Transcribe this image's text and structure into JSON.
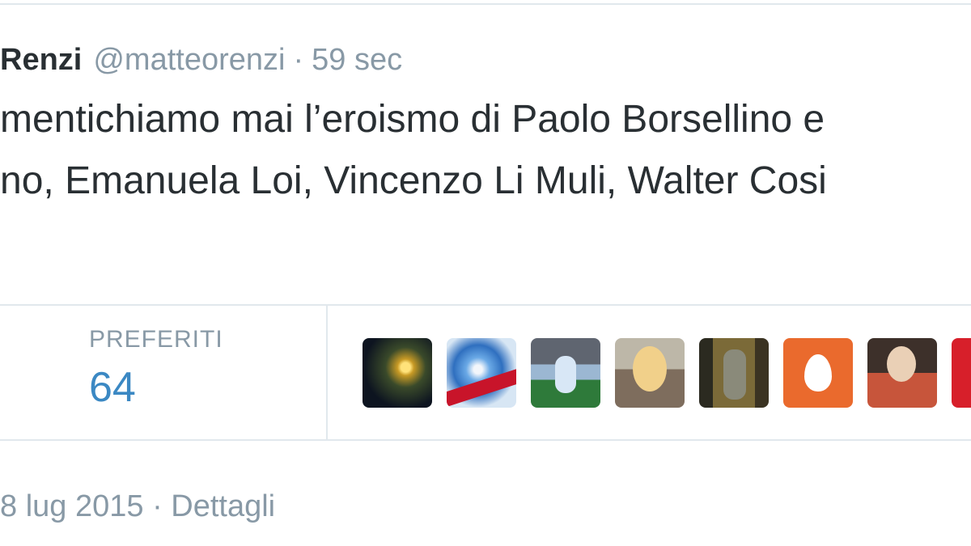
{
  "tweet": {
    "author_name": "Renzi",
    "handle": "@matteorenzi",
    "separator": "·",
    "time": "59 sec",
    "text_lines": [
      "mentichiamo mai l’eroismo di Paolo Borsellino e",
      "no, Emanuela Loi, Vincenzo Li Muli, Walter Cosi"
    ]
  },
  "stats": {
    "favorites_label": "PREFERITI",
    "favorites_count": "64"
  },
  "avatars": [
    {
      "icon": "earth-from-space-avatar"
    },
    {
      "icon": "globe-logo-avatar"
    },
    {
      "icon": "football-player-avatar"
    },
    {
      "icon": "blonde-woman-avatar"
    },
    {
      "icon": "man-in-suit-avatar"
    },
    {
      "icon": "default-egg-avatar",
      "color": "#ea6a2d"
    },
    {
      "icon": "woman-portrait-avatar"
    },
    {
      "icon": "red-avatar",
      "color": "#d71f2a"
    }
  ],
  "footer": {
    "date": "8 lug 2015",
    "separator": "·",
    "details_label": "Dettagli"
  },
  "colors": {
    "text": "#292f33",
    "secondary": "#8899a6",
    "count_blue": "#3b88c3",
    "border": "#e1e8ed"
  }
}
